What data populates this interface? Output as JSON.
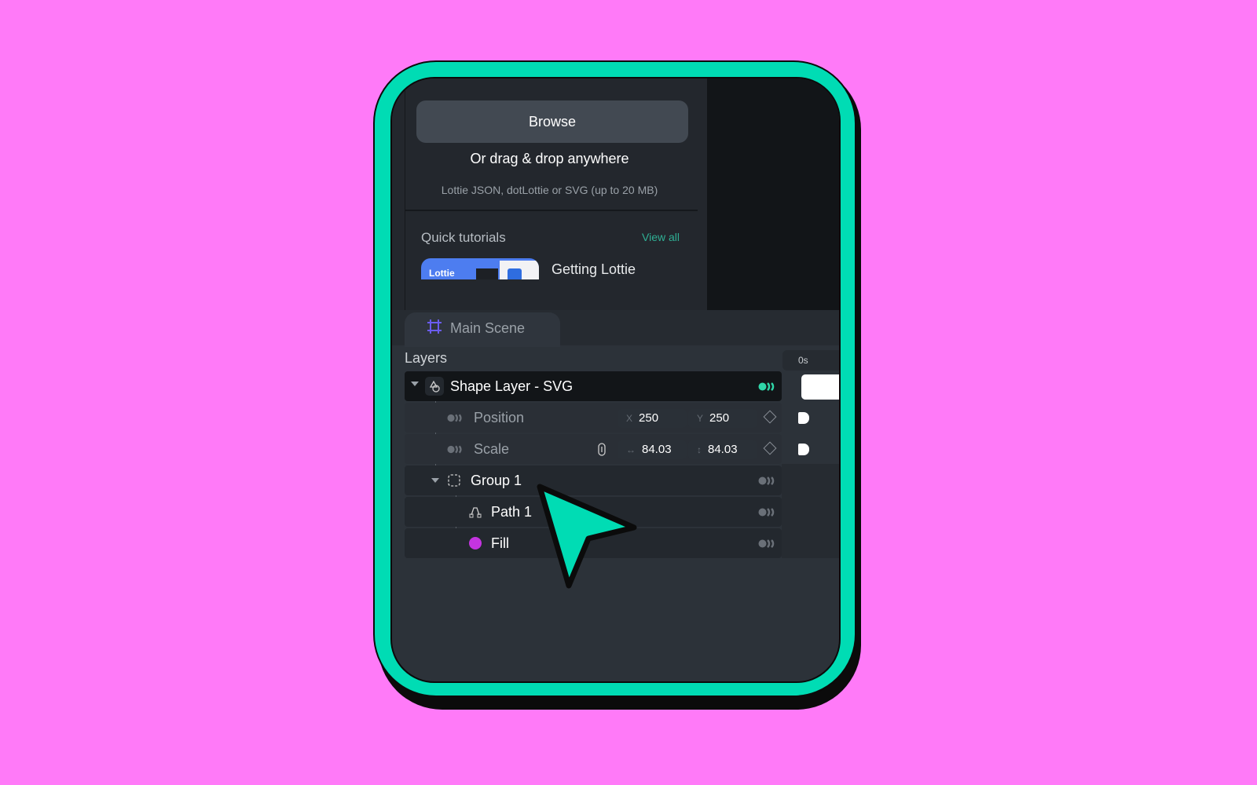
{
  "upload": {
    "browse_label": "Browse",
    "drag_text": "Or drag & drop anywhere",
    "formats_text": "Lottie JSON, dotLottie or SVG (up to 20 MB)"
  },
  "tutorials": {
    "title": "Quick tutorials",
    "view_all": "View all",
    "items": [
      {
        "thumb_label": "Lottie",
        "title": "Getting Lottie"
      }
    ]
  },
  "scene_tab": {
    "label": "Main Scene",
    "icon": "frame-icon"
  },
  "layers": {
    "title": "Layers",
    "timeline_start": "0s",
    "shape_layer": {
      "name": "Shape Layer - SVG",
      "icon": "shapes-icon"
    },
    "position": {
      "label": "Position",
      "x_axis": "X",
      "x": "250",
      "y_axis": "Y",
      "y": "250"
    },
    "scale": {
      "label": "Scale",
      "w": "84.03",
      "h": "84.03"
    },
    "group": {
      "name": "Group 1",
      "icon": "group-icon"
    },
    "path": {
      "name": "Path 1",
      "icon": "path-icon"
    },
    "fill": {
      "name": "Fill",
      "color": "#c434e0"
    }
  },
  "colors": {
    "background": "#ff7af8",
    "frame": "#00dcb4",
    "accent": "#2faf94",
    "cursor": "#00dcb4"
  }
}
